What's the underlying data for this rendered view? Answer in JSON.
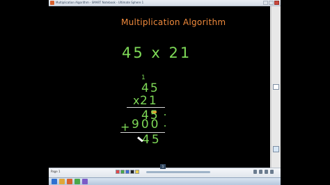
{
  "window": {
    "title": "Multiplication Algorithm - SMART Notebook - Ultimate Sphere 1"
  },
  "board": {
    "heading": "Multiplication Algorithm",
    "problem": "45 x 21",
    "carry_digit": "1",
    "top_number": "45",
    "times_sign": "x",
    "bottom_number": "21",
    "partial_product_1": "45",
    "plus_sign": "+",
    "partial_product_2": "900",
    "result": "45",
    "colors": {
      "background": "#000000",
      "heading": "#f08a3c",
      "writing": "#7ed957",
      "highlight": "#e89b2e",
      "rule_line": "#d8d8d8"
    }
  },
  "toolbar": {
    "page_label": "Page 1",
    "page_badge": "1"
  },
  "icons": {
    "app": "smart-notebook-icon",
    "minimize": "minimize-icon",
    "maximize": "maximize-icon",
    "close": "close-icon",
    "pen_cursor": "pen-cursor-icon",
    "scroll_pin": "pin-icon"
  }
}
